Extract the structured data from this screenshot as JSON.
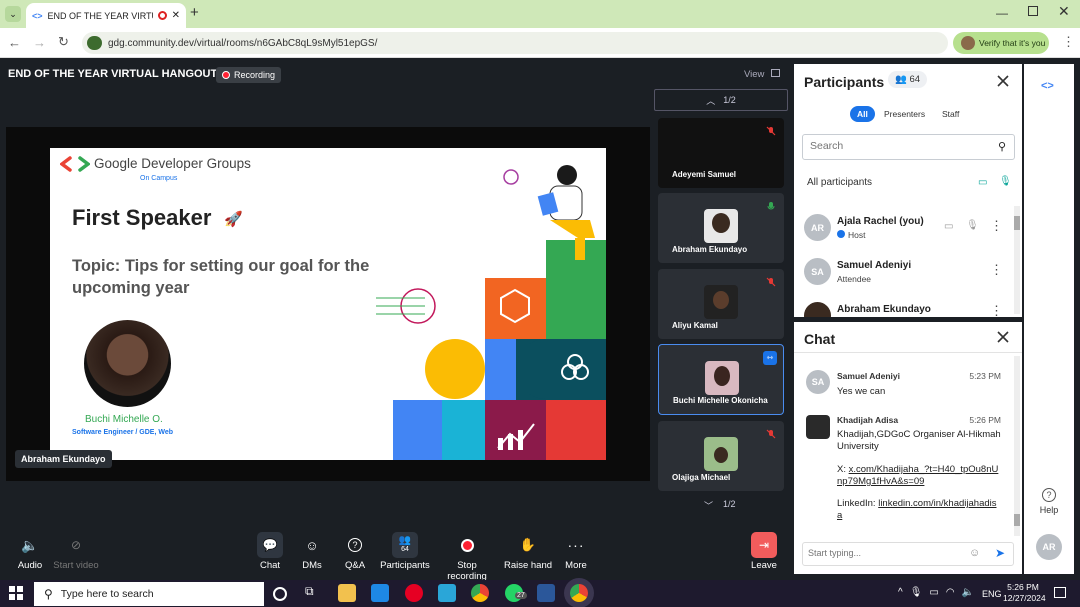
{
  "browser": {
    "tab_title": "END OF THE YEAR VIRTUAL",
    "url": "gdg.community.dev/virtual/rooms/n6GAbC8qL9sMyl51epGS/",
    "verify_label": "Verify that it's you"
  },
  "meeting": {
    "title": "END OF THE YEAR VIRTUAL HANGOUT",
    "recording_label": "Recording",
    "view_label": "View",
    "presenter_chip": "Abraham Ekundayo"
  },
  "slide": {
    "brand": "Google Developer Groups",
    "campus": "On Campus",
    "heading": "First Speaker",
    "topic": "Topic: Tips for setting our goal for the upcoming year",
    "speaker_name": "Buchi Michelle O.",
    "speaker_role": "Software Engineer / GDE, Web"
  },
  "thumbnails": {
    "page_top": "1/2",
    "page_bottom": "1/2",
    "items": [
      {
        "name": "Adeyemi Samuel",
        "mic": "muted"
      },
      {
        "name": "Abraham Ekundayo",
        "mic": "on"
      },
      {
        "name": "Aliyu Kamal",
        "mic": "muted"
      },
      {
        "name": "Buchi Michelle Okonicha",
        "mic": "presenting"
      },
      {
        "name": "Olajiga Michael",
        "mic": "muted"
      }
    ]
  },
  "participants": {
    "title": "Participants",
    "count": "64",
    "filters": [
      "All",
      "Presenters",
      "Staff"
    ],
    "active_filter": "All",
    "search_placeholder": "Search",
    "all_label": "All participants",
    "list": [
      {
        "initials": "AR",
        "name": "Ajala Rachel (you)",
        "role": "Host"
      },
      {
        "initials": "SA",
        "name": "Samuel Adeniyi",
        "role": "Attendee"
      },
      {
        "initials": "",
        "name": "Abraham Ekundayo",
        "role": ""
      }
    ]
  },
  "chat": {
    "title": "Chat",
    "input_placeholder": "Start typing...",
    "messages": [
      {
        "initials": "SA",
        "sender": "Samuel Adeniyi",
        "time": "5:23 PM",
        "text": "Yes we can"
      },
      {
        "initials": "",
        "sender": "Khadijah Adisa",
        "time": "5:26 PM",
        "line1": "Khadijah,GDGoC Organiser Al-Hikmah University",
        "x_prefix": "X: ",
        "x_link": "x.com/Khadijaha_?t=H40_tpOu8nUnp79Mg1fHvA&s=09",
        "li_prefix": "LinkedIn: ",
        "li_link": "linkedin.com/in/khadijahadisa"
      }
    ]
  },
  "controls": {
    "audio": "Audio",
    "start_video": "Start video",
    "chat": "Chat",
    "dms": "DMs",
    "qa": "Q&A",
    "participants": "Participants",
    "participants_badge": "64",
    "stop_recording": "Stop recording",
    "raise_hand": "Raise hand",
    "more": "More",
    "leave": "Leave"
  },
  "rail": {
    "help": "Help",
    "avatar": "AR"
  },
  "taskbar": {
    "search_placeholder": "Type here to search",
    "whatsapp_badge": "27",
    "lang": "ENG",
    "time": "5:26 PM",
    "date": "12/27/2024"
  },
  "colors": {
    "accent_blue": "#1a73e8",
    "leave_red": "#f25c5c",
    "recording_red": "#ff2233",
    "verify_green": "#b7e08e"
  }
}
